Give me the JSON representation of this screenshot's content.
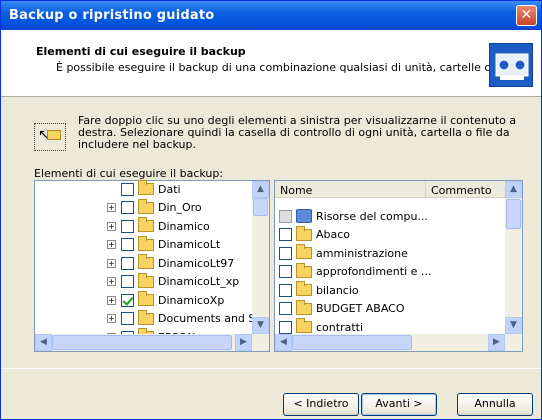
{
  "window": {
    "title": "Backup o ripristino guidato",
    "close_glyph": "✕"
  },
  "header": {
    "title": "Elementi di cui eseguire il backup",
    "subtitle": "È possibile eseguire il backup di una combinazione qualsiasi di unità, cartelle o file."
  },
  "hint": {
    "text": "Fare doppio clic su uno degli elementi a sinistra per visualizzarne il contenuto a destra. Selezionare quindi la casella di controllo di ogni unità, cartella o file da includere nel backup."
  },
  "items_label": "Elementi di cui eseguire il backup:",
  "tree": {
    "items": [
      {
        "label": "Dati",
        "expandable": false,
        "checked": false
      },
      {
        "label": "Din_Oro",
        "expandable": true,
        "checked": false
      },
      {
        "label": "Dinamico",
        "expandable": true,
        "checked": false
      },
      {
        "label": "DinamicoLt",
        "expandable": true,
        "checked": false
      },
      {
        "label": "DinamicoLt97",
        "expandable": true,
        "checked": false
      },
      {
        "label": "DinamicoLt_xp",
        "expandable": true,
        "checked": false
      },
      {
        "label": "DinamicoXp",
        "expandable": true,
        "checked": true
      },
      {
        "label": "Documents and S",
        "expandable": true,
        "checked": false
      },
      {
        "label": "EPSON",
        "expandable": true,
        "checked": false
      }
    ]
  },
  "list": {
    "columns": {
      "name": "Nome",
      "comment": "Commento"
    },
    "items": [
      {
        "label": "Risorse del compu...",
        "type": "computer"
      },
      {
        "label": "Abaco",
        "type": "folder"
      },
      {
        "label": "amministrazione",
        "type": "folder"
      },
      {
        "label": "approfondimenti e ...",
        "type": "folder"
      },
      {
        "label": "bilancio",
        "type": "folder"
      },
      {
        "label": "BUDGET ABACO",
        "type": "folder"
      },
      {
        "label": "contratti",
        "type": "folder"
      }
    ]
  },
  "buttons": {
    "back": "< Indietro",
    "next": "Avanti >",
    "cancel": "Annulla"
  },
  "scroll": {
    "up": "▲",
    "down": "▼",
    "left": "◀",
    "right": "▶"
  }
}
